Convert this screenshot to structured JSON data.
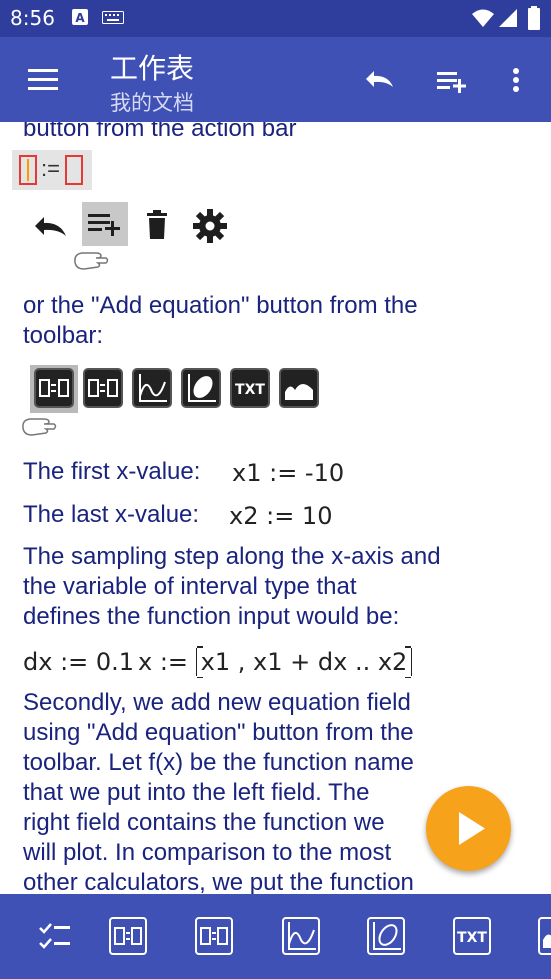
{
  "status_bar": {
    "time": "8:56"
  },
  "app_bar": {
    "title": "工作表",
    "subtitle": "我的文档"
  },
  "content": {
    "line_top": "button from the action bar",
    "formula_sample_op": ":=",
    "para_toolbar_1": "or the \"Add equation\" button from the",
    "para_toolbar_2": "toolbar:",
    "toolbar_txt_label": "TXT",
    "first_x_label": "The first x-value:",
    "first_x_eq": "x1 := -10",
    "last_x_label": "The last x-value:",
    "last_x_eq": "x2 := 10",
    "sampling_1": "The sampling step along the x-axis and",
    "sampling_2": "the variable of interval type that",
    "sampling_3": "defines the function input would be:",
    "dx_eq": "dx := 0.1",
    "x_eq_lhs": "x :=",
    "x_eq_inner": "x1 , x1 + dx .. x2",
    "second_1": "Secondly, we add new equation field",
    "second_2": "using \"Add equation\" button from the",
    "second_3": "toolbar. Let f(x) be the function name",
    "second_4": "that we put into the left field. The",
    "second_5": "right field contains the function we",
    "second_6": "will plot. In comparison to the most",
    "second_7": "other calculators, we put the function"
  },
  "bottom_bar": {
    "txt_label": "TXT"
  },
  "colors": {
    "app_bar": "#3f51b5",
    "status_bar": "#2f3d9c",
    "text": "#1a237e",
    "fab": "#f7a21b"
  }
}
